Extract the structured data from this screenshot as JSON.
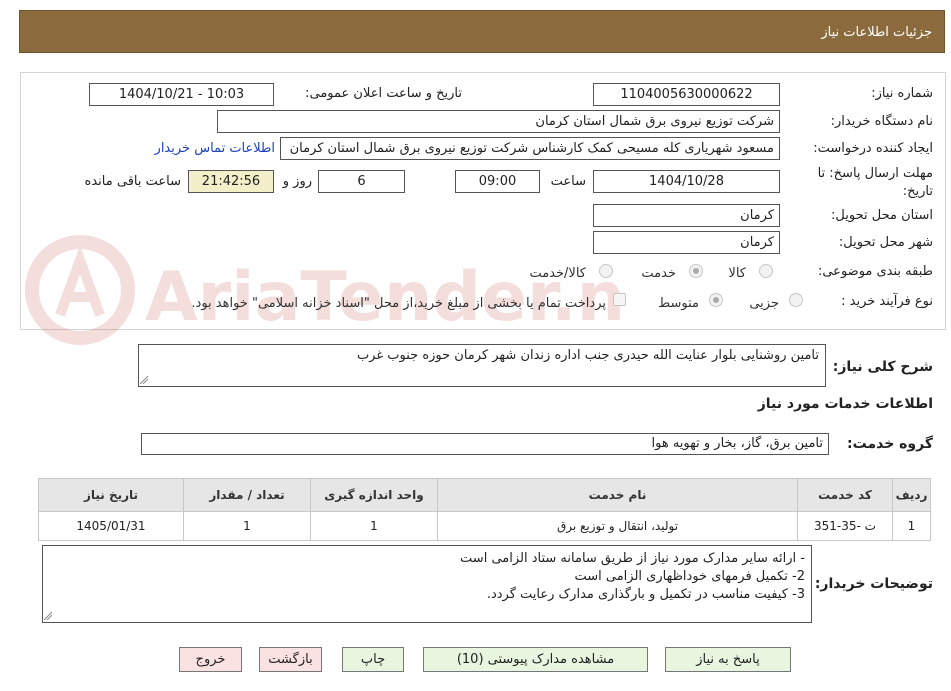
{
  "header": {
    "title": "جزئیات اطلاعات نیاز"
  },
  "form": {
    "need_number_label": "شماره نیاز:",
    "need_number": "1104005630000622",
    "announce_label": "تاریخ و ساعت اعلان عمومی:",
    "announce_value": "1404/10/21 - 10:03",
    "buyer_org_label": "نام دستگاه خریدار:",
    "buyer_org": "شرکت توزیع نیروی برق شمال استان کرمان",
    "requester_label": "ایجاد کننده درخواست:",
    "requester": "مسعود شهریاری کله مسیحی کمک کارشناس شرکت توزیع نیروی برق شمال استان کرمان",
    "contact_link": "اطلاعات تماس خریدار",
    "deadline_label_line1": "مهلت ارسال پاسخ: تا",
    "deadline_label_line2": "تاریخ:",
    "deadline_date": "1404/10/28",
    "time_label": "ساعت",
    "deadline_time": "09:00",
    "days_value": "6",
    "days_label": "روز و",
    "remaining_time": "21:42:56",
    "remaining_label": "ساعت باقی مانده",
    "province_label": "استان محل تحویل:",
    "province": "کرمان",
    "city_label": "شهر محل تحویل:",
    "city": "کرمان",
    "category_label": "طبقه بندی موضوعی:",
    "category_options": [
      "کالا",
      "خدمت",
      "کالا/خدمت"
    ],
    "category_selected": "خدمت",
    "process_label": "نوع فرآیند خرید :",
    "process_options": [
      "جزیی",
      "متوسط"
    ],
    "process_selected": "متوسط",
    "payment_note": "پرداخت تمام یا بخشی از مبلغ خرید،از محل \"اسناد خزانه اسلامی\" خواهد بود."
  },
  "watermark": {
    "text": "AriaTender.neT"
  },
  "summary": {
    "label": "شرح کلی نیاز:",
    "text": "تامین روشنایی بلوار عنایت الله حیدری جنب اداره زندان شهر کرمان حوزه جنوب غرب"
  },
  "services": {
    "section_title": "اطلاعات خدمات مورد نیاز",
    "group_label": "گروه خدمت:",
    "group_value": "تامین برق، گاز، بخار و تهویه هوا",
    "columns": [
      "ردیف",
      "کد خدمت",
      "نام خدمت",
      "واحد اندازه گیری",
      "تعداد / مقدار",
      "تاریخ نیاز"
    ],
    "rows": [
      {
        "row": "1",
        "code": "ت -35-351",
        "name": "تولید، انتقال و توزیع برق",
        "unit": "1",
        "qty": "1",
        "date": "1405/01/31"
      }
    ]
  },
  "buyer_notes": {
    "label": "توضیحات خریدار:",
    "lines": [
      "- ارائه سایر مدارک مورد نیاز از طریق سامانه ستاد الزامی است",
      "2- تکمیل فرمهای خوداظهاری الزامی است",
      "3- کیفیت مناسب در تکمیل و بارگذاری مدارک رعایت گردد."
    ]
  },
  "buttons": {
    "reply": "پاسخ به نیاز",
    "attachments": "مشاهده مدارک پیوستی (10)",
    "print": "چاپ",
    "back": "بازگشت",
    "exit": "خروج"
  },
  "colors": {
    "header_bg": "#8b6b3e",
    "button_green": "#e8f6e0",
    "button_red": "#fbe2e2",
    "timer_bg": "#f3f0c9",
    "link": "#1a3fbf"
  }
}
